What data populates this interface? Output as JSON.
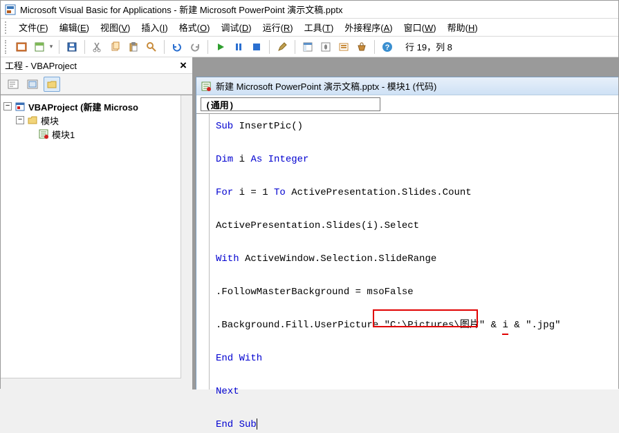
{
  "title": "Microsoft Visual Basic for Applications - 新建 Microsoft PowerPoint 演示文稿.pptx",
  "menu": [
    "文件(F)",
    "编辑(E)",
    "视图(V)",
    "插入(I)",
    "格式(O)",
    "调试(D)",
    "运行(R)",
    "工具(T)",
    "外接程序(A)",
    "窗口(W)",
    "帮助(H)"
  ],
  "status": "行 19，列 8",
  "proj_panel_title": "工程 - VBAProject",
  "tree": {
    "root": "VBAProject (新建 Microso",
    "folder": "模块",
    "module": "模块1"
  },
  "mdi": {
    "title": "新建 Microsoft PowerPoint 演示文稿.pptx - 模块1 (代码)",
    "dropdown_left": "(通用)"
  },
  "code": {
    "l1a": "Sub",
    "l1b": " InsertPic()",
    "l2a": "Dim",
    "l2b": " i ",
    "l2c": "As Integer",
    "l3a": "For",
    "l3b": " i = 1 ",
    "l3c": "To",
    "l3d": " ActivePresentation.Slides.Count",
    "l4": "ActivePresentation.Slides(i).Select",
    "l5a": "With",
    "l5b": " ActiveWindow.Selection.SlideRange",
    "l6": ".FollowMasterBackground = msoFalse",
    "l7a": ".Background.Fill.UserPicture ",
    "l7b": "\"C:\\Pictures\\图片\"",
    "l7c": " & ",
    "l7d": "i",
    "l7e": " & \".jpg\"",
    "l8": "End With",
    "l9": "Next",
    "l10": "End Sub"
  }
}
